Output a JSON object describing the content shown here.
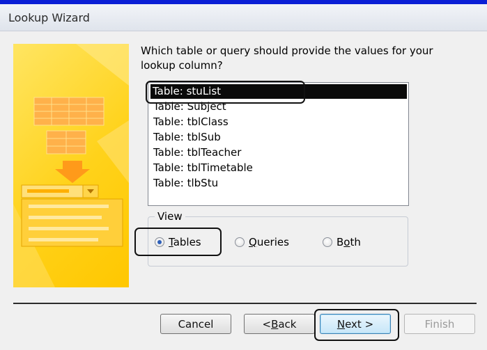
{
  "window": {
    "title": "Lookup Wizard"
  },
  "prompt": {
    "question": "Which table or query should provide the values for your lookup column?"
  },
  "list": {
    "items": [
      "Table: stuList",
      "Table: Subject",
      "Table: tblClass",
      "Table: tblSub",
      "Table: tblTeacher",
      "Table: tblTimetable",
      "Table: tlbStu"
    ],
    "selected_index": 0
  },
  "view": {
    "legend": "View",
    "options": [
      {
        "key": "T",
        "rest": "ables",
        "checked": true
      },
      {
        "key": "Q",
        "rest": "ueries",
        "checked": false
      },
      {
        "key": "o",
        "pre": "B",
        "rest": "th",
        "checked": false
      }
    ]
  },
  "buttons": {
    "cancel": "Cancel",
    "back_prefix": "< ",
    "back_key": "B",
    "back_rest": "ack",
    "next_key": "N",
    "next_rest": "ext >",
    "finish": "Finish"
  },
  "colors": {
    "accent_bar": "#0a1fd6",
    "side_panel": "#ffd21a",
    "selection": "#0a0a0a"
  }
}
